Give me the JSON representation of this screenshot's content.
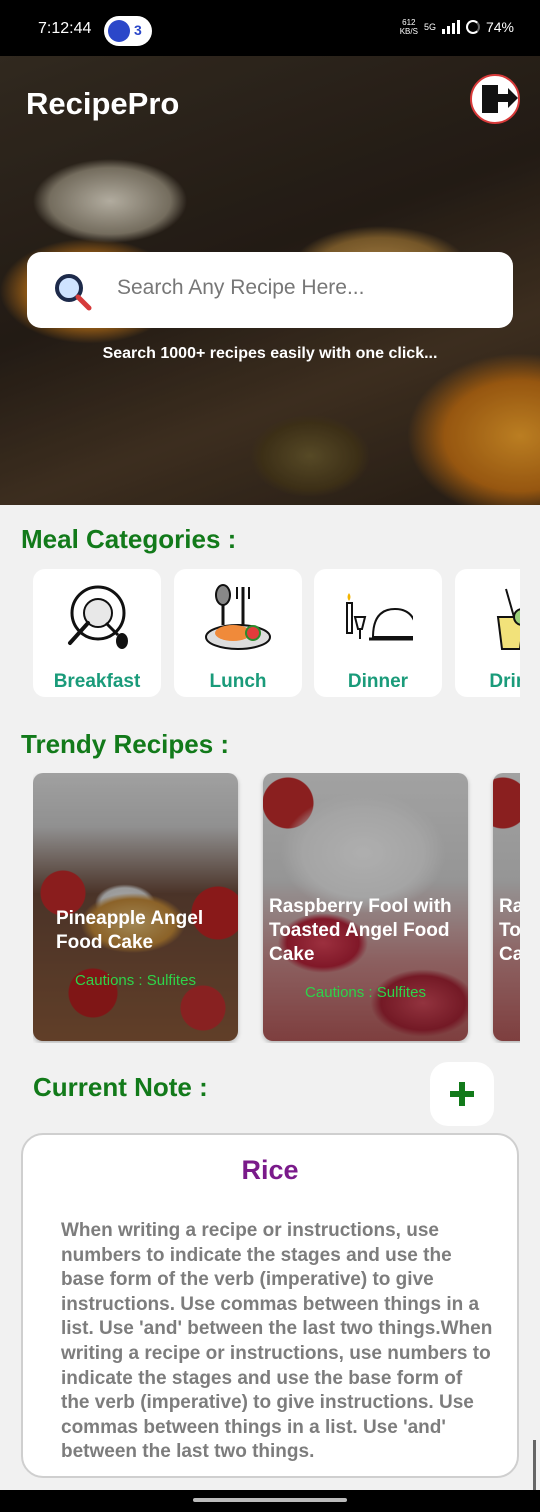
{
  "status_bar": {
    "time": "7:12:44",
    "notification_count": "3",
    "net_speed_value": "612",
    "net_speed_unit": "KB/S",
    "network": "5G",
    "battery": "74%"
  },
  "header": {
    "app_title": "RecipePro",
    "search_placeholder": "Search Any Recipe Here...",
    "search_caption": "Search 1000+ recipes easily with one click..."
  },
  "categories": {
    "title": "Meal Categories :",
    "items": [
      {
        "label": "Breakfast",
        "icon": "breakfast-icon"
      },
      {
        "label": "Lunch",
        "icon": "lunch-icon"
      },
      {
        "label": "Dinner",
        "icon": "dinner-icon"
      },
      {
        "label": "Drinks",
        "icon": "drinks-icon"
      }
    ]
  },
  "trendy": {
    "title": "Trendy Recipes :",
    "items": [
      {
        "name": "Pineapple Angel Food Cake",
        "caution": "Cautions : Sulfites"
      },
      {
        "name": "Raspberry Fool with Toasted Angel Food Cake",
        "caution": "Cautions : Sulfites"
      },
      {
        "name": "Raspberry Fool with Toasted Angel Food Cake",
        "caution": ""
      }
    ]
  },
  "note": {
    "title": "Current Note :",
    "add_label": "+",
    "heading": "Rice",
    "body": "When writing a recipe or instructions, use numbers to indicate the stages and use the base form of the verb (imperative) to give instructions. Use commas between things in a list. Use 'and' between the last two things.When writing a recipe or instructions, use numbers to indicate the stages and use the base form of the verb (imperative) to give instructions. Use commas between things in a list. Use 'and' between the last two things."
  },
  "colors": {
    "section_title": "#127a1a",
    "category_label": "#1a9b7a",
    "note_heading": "#7a1a8a",
    "caution": "#2ed34a"
  }
}
